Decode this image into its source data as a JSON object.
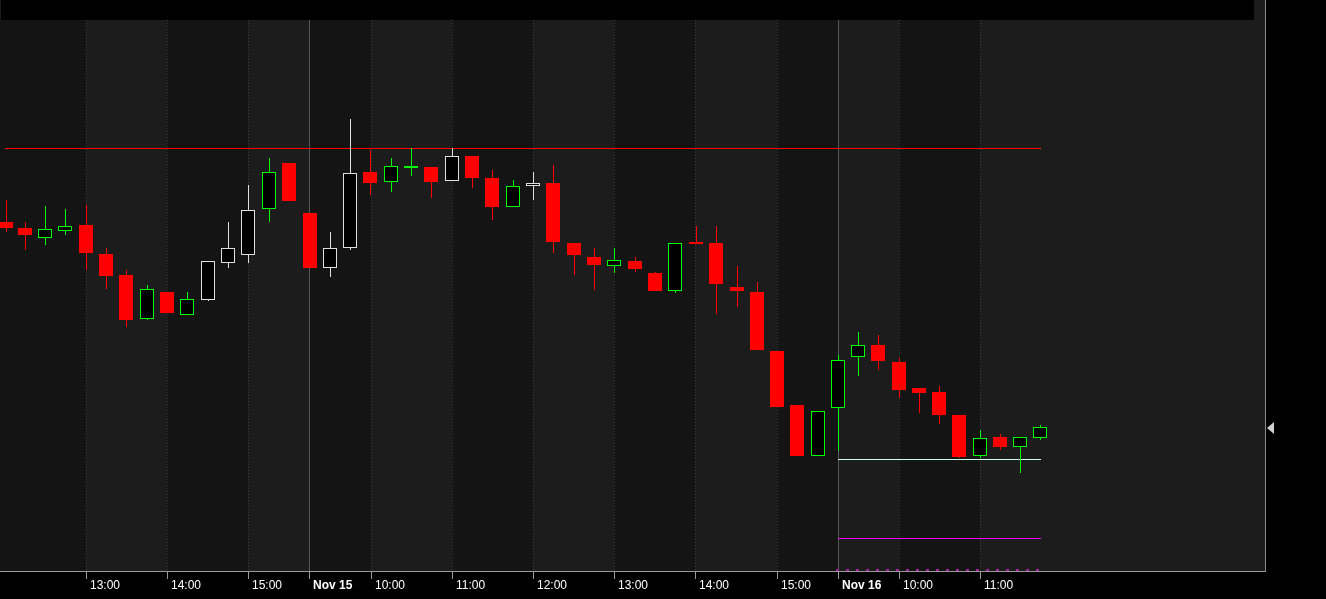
{
  "chart": {
    "x_labels": [
      {
        "text": "13:00",
        "kind": "time"
      },
      {
        "text": "14:00",
        "kind": "time"
      },
      {
        "text": "15:00",
        "kind": "time"
      },
      {
        "text": "Nov 15",
        "kind": "date"
      },
      {
        "text": "10:00",
        "kind": "time"
      },
      {
        "text": "11:00",
        "kind": "time"
      },
      {
        "text": "12:00",
        "kind": "time"
      },
      {
        "text": "13:00",
        "kind": "time"
      },
      {
        "text": "14:00",
        "kind": "time"
      },
      {
        "text": "15:00",
        "kind": "time"
      },
      {
        "text": "Nov 16",
        "kind": "date"
      },
      {
        "text": "10:00",
        "kind": "time"
      },
      {
        "text": "11:00",
        "kind": "time"
      }
    ]
  }
}
